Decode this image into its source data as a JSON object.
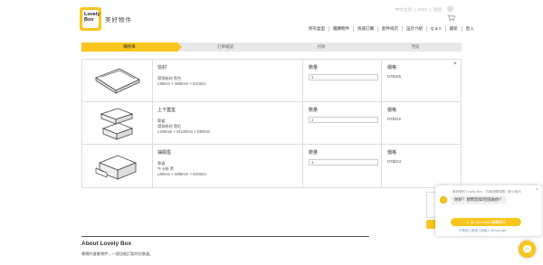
{
  "brand": {
    "logo_line1": "Lovely",
    "logo_line2": "Box",
    "name": "美好物件"
  },
  "header": {
    "lang_items": [
      "中文主頁",
      "ENG",
      "登錄"
    ],
    "help_glyph": "?",
    "cart_icon": "cart-icon"
  },
  "nav": {
    "items": [
      "所有盒型",
      "獨購物件",
      "快速訂購",
      "配件商店",
      "設計介紹",
      "Q & A",
      "最新",
      "登入"
    ]
  },
  "steps": {
    "items": [
      "購物車",
      "訂單確認",
      "付款",
      "完成"
    ],
    "active_index": 0
  },
  "table": {
    "rows": [
      {
        "name": "信封",
        "lines": [
          "環保紙材 黑色",
          "L95mm × W60mm × D10mm"
        ],
        "qty_label": "數量",
        "qty": "1",
        "price_label": "價格",
        "price": "NT$185",
        "image": "envelope-box-illustration"
      },
      {
        "name": "上下蓋盒",
        "lines": [
          "單盒",
          "環保紙材 雪紅",
          "L200mm × W130mm × D50mm"
        ],
        "qty_label": "數量",
        "qty": "1",
        "price_label": "價格",
        "price": "NT$315",
        "image": "lid-box-illustration"
      },
      {
        "name": "抽屜盒",
        "lines": [
          "單盒",
          "牛卡紙 黑",
          "L80mm × W58mm × D20mm"
        ],
        "qty_label": "數量",
        "qty": "1",
        "price_label": "價格",
        "price": "NT$204",
        "image": "drawer-box-illustration"
      }
    ],
    "remove_glyph": "×"
  },
  "about": {
    "title": "About Lovely Box",
    "text": "專屬的盒裝物件，一個也能訂製的包裝盒。"
  },
  "chat": {
    "header": "美好物件 Lovely Box · 平常回覆時間：數小時內",
    "message": "你好！想問您如何協助你？",
    "cta": "☺ 以 Yes Hello 繼續聊天",
    "footer": "不需登入帳號 | 請輸入 Messenger",
    "close_glyph": "×",
    "accent_color": "#f8c61c"
  },
  "colors": {
    "brand_yellow": "#f8c61c",
    "border": "#dddddd"
  }
}
